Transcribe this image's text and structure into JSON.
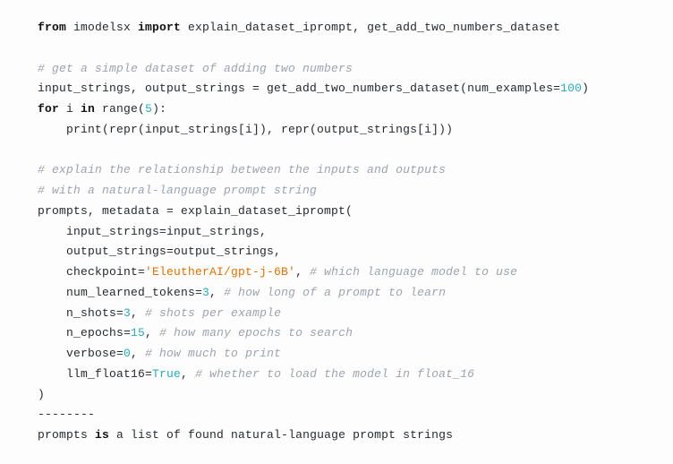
{
  "code": {
    "l1": {
      "kw1": "from",
      "mod": " imodelsx ",
      "kw2": "import",
      "names": " explain_dataset_iprompt, get_add_two_numbers_dataset"
    },
    "l3": {
      "cm": "# get a simple dataset of adding two numbers"
    },
    "l4": {
      "a": "input_strings, output_strings = get_add_two_numbers_dataset(num_examples=",
      "n": "100",
      "b": ")"
    },
    "l5": {
      "kw1": "for",
      "a": " i ",
      "kw2": "in",
      "b": " range(",
      "n": "5",
      "c": "):"
    },
    "l6": {
      "a": "    print(repr(input_strings[i]), repr(output_strings[i]))"
    },
    "l8": {
      "cm": "# explain the relationship between the inputs and outputs"
    },
    "l9": {
      "cm": "# with a natural-language prompt string"
    },
    "l10": {
      "a": "prompts, metadata = explain_dataset_iprompt("
    },
    "l11": {
      "a": "    input_strings=input_strings,"
    },
    "l12": {
      "a": "    output_strings=output_strings,"
    },
    "l13": {
      "a": "    checkpoint=",
      "s": "'EleutherAI/gpt-j-6B'",
      "b": ", ",
      "cm": "# which language model to use"
    },
    "l14": {
      "a": "    num_learned_tokens=",
      "n": "3",
      "b": ", ",
      "cm": "# how long of a prompt to learn"
    },
    "l15": {
      "a": "    n_shots=",
      "n": "3",
      "b": ", ",
      "cm": "# shots per example"
    },
    "l16": {
      "a": "    n_epochs=",
      "n": "15",
      "b": ", ",
      "cm": "# how many epochs to search"
    },
    "l17": {
      "a": "    verbose=",
      "n": "0",
      "b": ", ",
      "cm": "# how much to print"
    },
    "l18": {
      "a": "    llm_float16=",
      "bl": "True",
      "b": ", ",
      "cm": "# whether to load the model in float_16"
    },
    "l19": {
      "a": ")"
    },
    "l20": {
      "a": "--------"
    },
    "l21": {
      "a": "prompts ",
      "kw": "is",
      "b": " a list of found natural-language prompt strings"
    }
  }
}
